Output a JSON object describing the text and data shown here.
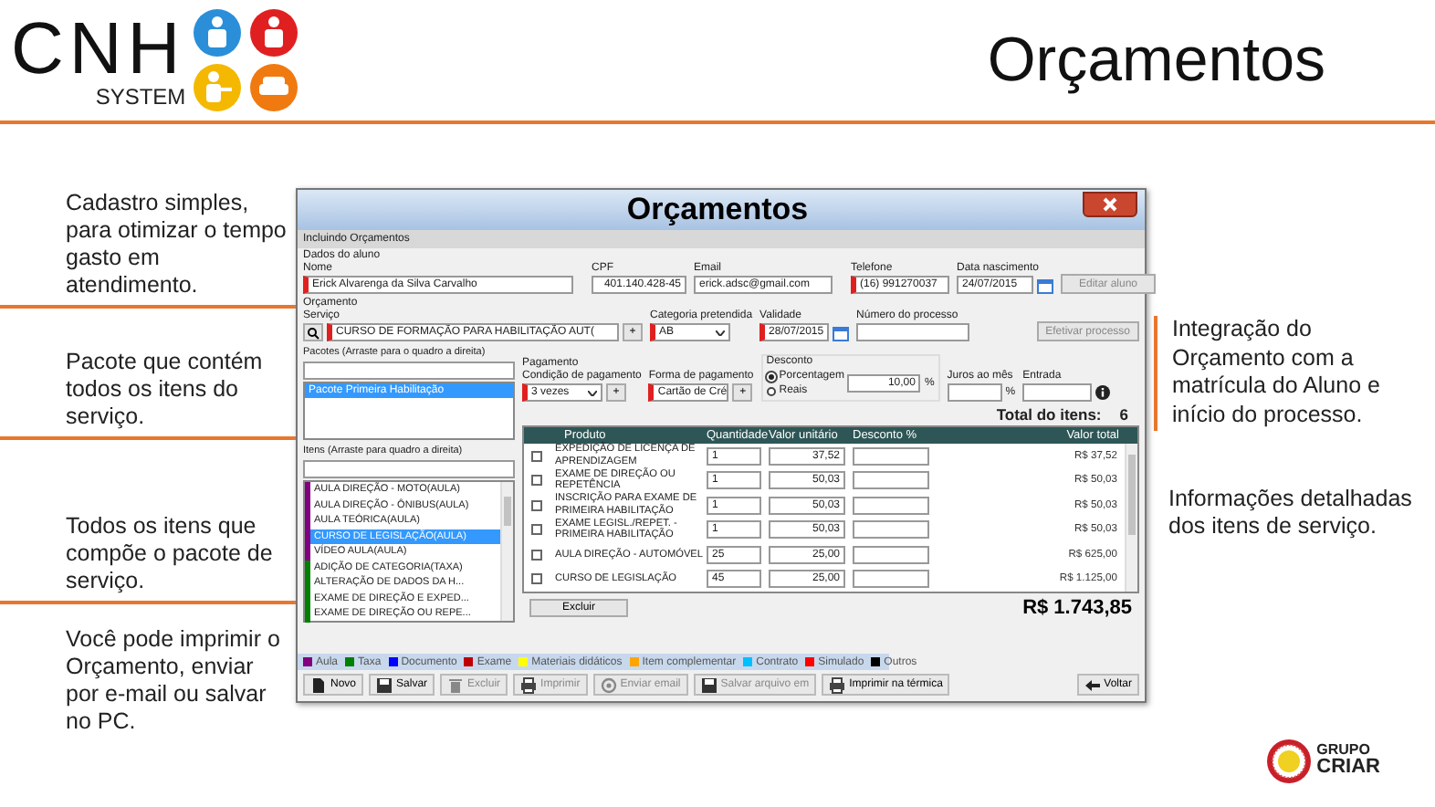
{
  "header": {
    "logo_text": "CNH",
    "logo_subtext": "SYSTEM",
    "title": "Orçamentos"
  },
  "notes_left": [
    "Cadastro simples, para otimizar o tempo gasto em atendimento.",
    "Pacote que contém todos os itens do serviço.",
    "Todos os itens que compõe o pacote de serviço.",
    "Você pode imprimir o Orçamento, enviar por e-mail ou salvar no PC."
  ],
  "notes_right": [
    "Integração do Orçamento com a matrícula do Aluno e início do processo.",
    "Informações detalhadas dos itens de serviço."
  ],
  "window": {
    "title": "Orçamentos",
    "status": "Incluindo Orçamentos",
    "student": {
      "heading": "Dados do aluno",
      "fields": [
        {
          "label": "Nome",
          "value": "Erick Alvarenga da Silva Carvalho",
          "required": true
        },
        {
          "label": "CPF",
          "value": "401.140.428-45",
          "required": false
        },
        {
          "label": "Email",
          "value": "erick.adsc@gmail.com",
          "required": false
        },
        {
          "label": "Telefone",
          "value": "(16) 991270037",
          "required": true
        },
        {
          "label": "Data nascimento",
          "value": "24/07/2015",
          "required": false
        }
      ],
      "button": {
        "label": "Editar aluno",
        "disabled": true
      }
    },
    "budget": {
      "heading": "Orçamento",
      "service": {
        "label": "Serviço",
        "value": "CURSO DE FORMAÇÃO PARA HABILITAÇÃO AUT(",
        "required": true
      },
      "add_button": "+",
      "category": {
        "label": "Categoria pretendida",
        "value": "AB",
        "required": true
      },
      "validity": {
        "label": "Validade",
        "value": "28/07/2015",
        "required": true
      },
      "process": {
        "label": "Número do processo"
      },
      "button": {
        "label": "Efetivar processo",
        "disabled": true
      }
    },
    "packages": {
      "label": "Pacotes (Arraste para o quadro a direita)",
      "items": [
        {
          "label": "Pacote Primeira Habilitação",
          "selected": true
        }
      ]
    },
    "items": {
      "label": "Itens (Arraste para quadro a direita)",
      "entries": [
        {
          "label": "AULA DIREÇÃO - MOTO(AULA)",
          "color": "#800080",
          "selected": false
        },
        {
          "label": "AULA DIREÇÃO - ÔNIBUS(AULA)",
          "color": "#800080",
          "selected": false
        },
        {
          "label": "AULA TEÓRICA(AULA)",
          "color": "#800080",
          "selected": false
        },
        {
          "label": "CURSO DE LEGISLAÇÃO(AULA)",
          "color": "#800080",
          "selected": true
        },
        {
          "label": "VÍDEO AULA(AULA)",
          "color": "#800080",
          "selected": false
        },
        {
          "label": "ADIÇÃO DE CATEGORIA(TAXA)",
          "color": "#008000",
          "selected": false
        },
        {
          "label": "ALTERAÇÃO DE DADOS DA H...",
          "color": "#008000",
          "selected": false
        },
        {
          "label": "EXAME DE DIREÇÃO E EXPED...",
          "color": "#008000",
          "selected": false
        },
        {
          "label": "EXAME DE DIREÇÃO OU REPE...",
          "color": "#008000",
          "selected": false
        }
      ]
    },
    "payment": {
      "heading": "Pagamento",
      "condition": {
        "label": "Condição de pagamento",
        "value": "3 vezes",
        "required": true
      },
      "condition_add": "+",
      "method": {
        "label": "Forma de pagamento",
        "value": "Cartão de Cré",
        "required": true
      },
      "method_add": "+"
    },
    "discount": {
      "heading": "Desconto",
      "options": [
        {
          "label": "Porcentagem",
          "selected": true
        },
        {
          "label": "Reais",
          "selected": false
        }
      ],
      "value": "10,00",
      "unit": "%"
    },
    "interest": {
      "label": "Juros ao mês",
      "unit": "%"
    },
    "down_payment": {
      "label": "Entrada"
    },
    "total_count": {
      "label": "Total do itens:",
      "value": "6"
    },
    "table": {
      "columns": [
        "Produto",
        "Quantidade",
        "Valor unitário",
        "Desconto %",
        "Valor total"
      ],
      "rows": [
        {
          "checked": false,
          "product": "EXPEDIÇÃO DE LICENÇA DE APRENDIZAGEM",
          "quantity": "1",
          "unit_price": "37,52",
          "total": "R$ 37,52"
        },
        {
          "checked": false,
          "product": "EXAME DE DIREÇÃO OU REPETÊNCIA",
          "quantity": "1",
          "unit_price": "50,03",
          "total": "R$ 50,03"
        },
        {
          "checked": false,
          "product": "INSCRIÇÃO PARA EXAME DE PRIMEIRA HABILITAÇÃO",
          "quantity": "1",
          "unit_price": "50,03",
          "total": "R$ 50,03"
        },
        {
          "checked": false,
          "product": "EXAME LEGISL./REPET. - PRIMEIRA HABILITAÇÃO",
          "quantity": "1",
          "unit_price": "50,03",
          "total": "R$ 50,03"
        },
        {
          "checked": false,
          "product": "AULA DIREÇÃO - AUTOMÓVEL",
          "quantity": "25",
          "unit_price": "25,00",
          "total": "R$ 625,00"
        },
        {
          "checked": false,
          "product": "CURSO DE LEGISLAÇÃO",
          "quantity": "45",
          "unit_price": "25,00",
          "total": "R$ 1.125,00"
        }
      ]
    },
    "delete_button": "Excluir",
    "grand_total": "R$ 1.743,85",
    "legend": [
      {
        "label": "Aula",
        "color": "#800080"
      },
      {
        "label": "Taxa",
        "color": "#008000"
      },
      {
        "label": "Documento",
        "color": "#0000ff"
      },
      {
        "label": "Exame",
        "color": "#c00000"
      },
      {
        "label": "Materiais didáticos",
        "color": "#ffff00"
      },
      {
        "label": "Item complementar",
        "color": "#ffa500"
      },
      {
        "label": "Contrato",
        "color": "#00bfff"
      },
      {
        "label": "Simulado",
        "color": "#ff0000"
      },
      {
        "label": "Outros",
        "color": "#000000"
      }
    ],
    "toolbar": [
      {
        "label": "Novo",
        "kind": "document",
        "disabled": false
      },
      {
        "label": "Salvar",
        "kind": "floppy",
        "disabled": false
      },
      {
        "label": "Excluir",
        "kind": "trash",
        "disabled": true
      },
      {
        "label": "Imprimir",
        "kind": "printer",
        "disabled": true
      },
      {
        "label": "Enviar email",
        "kind": "mail",
        "disabled": true
      },
      {
        "label": "Salvar arquivo em",
        "kind": "floppy",
        "disabled": true
      },
      {
        "label": "Imprimir na térmica",
        "kind": "printer",
        "disabled": false
      },
      {
        "label": "Voltar",
        "kind": "back",
        "disabled": false
      }
    ]
  },
  "footer": {
    "logo_top": "GRUPO",
    "logo_bottom": "CRIAR"
  }
}
